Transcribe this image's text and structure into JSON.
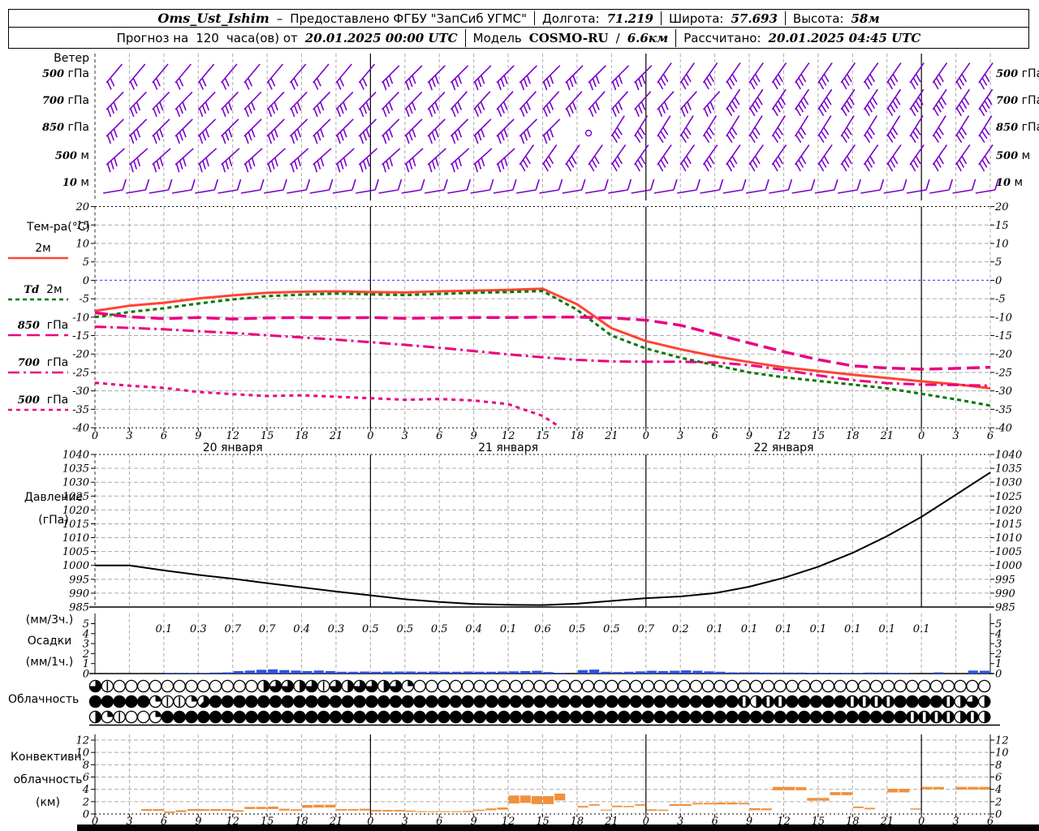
{
  "colors": {
    "wind": "#7A00CC",
    "t2m": "#FF4433",
    "td2m": "#007800",
    "magenta": "#EA0080",
    "zero_line": "#5050FF",
    "grid": "#AAAAAA",
    "precip_bar": "#2952E3",
    "conv_bar": "#F0913C",
    "pressure_line": "#000000"
  },
  "header": {
    "station": "Oms_Ust_Ishim",
    "dash": "–",
    "provided": "Предоставлено ФГБУ \"ЗапСиб УГМС\"",
    "lon_label": "Долгота:",
    "lon": "71.219",
    "lat_label": "Широта:",
    "lat": "57.693",
    "alt_label": "Высота:",
    "alt": "58м",
    "forecast_prefix": "Прогноз на",
    "forecast_hours": "120",
    "forecast_mid": "часа(ов) от",
    "forecast_start": "20.01.2025 00:00 UTC",
    "model_label": "Модель",
    "model": "COSMO-RU",
    "model_slash": "/",
    "model_res": "6.6км",
    "calc_label": "Рассчитано:",
    "calc_time": "20.01.2025 04:45 UTC"
  },
  "labels": {
    "wind_title": "Ветер",
    "temp_label": "Тем-ра(°C)",
    "pressure_label_1": "Давление",
    "pressure_label_2": "(гПа)",
    "precip_label_1": "(мм/3ч.)",
    "precip_label_2": "Осадки",
    "precip_label_3": "(мм/1ч.)",
    "cloud_label": "Облачность",
    "conv_label_1": "Конвективн.",
    "conv_label_2": "облачность",
    "conv_label_3": "(км)"
  },
  "wind": {
    "rows": [
      {
        "num": "500",
        "unit": "гПа",
        "segments": [
          [
            1,
            23,
            50,
            2
          ],
          [
            25,
            47,
            45,
            3
          ],
          [
            49,
            77,
            55,
            3
          ]
        ]
      },
      {
        "num": "700",
        "unit": "гПа",
        "segments": [
          [
            1,
            29,
            46,
            3
          ],
          [
            31,
            53,
            48,
            3
          ],
          [
            55,
            77,
            56,
            4
          ]
        ]
      },
      {
        "num": "850",
        "unit": "гПа",
        "segments": [
          [
            1,
            39,
            45,
            3
          ],
          [
            45,
            77,
            58,
            3
          ]
        ],
        "calm": [
          43
        ]
      },
      {
        "num": "500",
        "unit": "м",
        "segments": [
          [
            1,
            35,
            42,
            3
          ],
          [
            37,
            77,
            55,
            3
          ]
        ]
      },
      {
        "num": "10",
        "unit": "м",
        "segments": [
          [
            1,
            77,
            10,
            1
          ]
        ],
        "low": true
      }
    ]
  },
  "xaxis": {
    "hour_labels": [
      "0",
      "3",
      "6",
      "9",
      "12",
      "15",
      "18",
      "21",
      "0",
      "3",
      "6",
      "9",
      "12",
      "15",
      "18",
      "21",
      "0",
      "3",
      "6",
      "9",
      "12",
      "15",
      "18",
      "21",
      "0",
      "3",
      "6"
    ],
    "days": [
      {
        "label": "20 января",
        "h": 12
      },
      {
        "label": "21 января",
        "h": 36
      },
      {
        "label": "22 января",
        "h": 60
      }
    ]
  },
  "temp_legend": [
    {
      "num": "",
      "unit": "2м",
      "series": 0
    },
    {
      "num": "Td",
      "unit": "2м",
      "series": 1
    },
    {
      "num": "850",
      "unit": "гПа",
      "series": 2
    },
    {
      "num": "700",
      "unit": "гПа",
      "series": 3
    },
    {
      "num": "500",
      "unit": "гПа",
      "series": 4
    }
  ],
  "chart_data": [
    {
      "id": "temperature",
      "type": "line",
      "title": "Тем-ра(°C)",
      "ylim": [
        -40,
        20
      ],
      "yticks": [
        20,
        15,
        10,
        5,
        0,
        -5,
        -10,
        -15,
        -20,
        -25,
        -30,
        -35,
        -40
      ],
      "xlim_hours": [
        0,
        78
      ],
      "series": [
        {
          "name": "2м",
          "color": "#FF4433",
          "dash": "",
          "width": 3,
          "x": [
            0,
            3,
            6,
            9,
            12,
            15,
            18,
            21,
            24,
            27,
            30,
            33,
            36,
            39,
            42,
            45,
            48,
            51,
            54,
            57,
            60,
            63,
            66,
            69,
            72,
            75,
            78
          ],
          "values": [
            -8.3,
            -6.9,
            -6.1,
            -4.9,
            -4.1,
            -3.4,
            -3.1,
            -3.0,
            -3.2,
            -3.3,
            -3.0,
            -2.8,
            -2.6,
            -2.3,
            -6.5,
            -13.0,
            -16.5,
            -18.7,
            -20.6,
            -22.2,
            -23.6,
            -24.6,
            -25.6,
            -26.5,
            -27.4,
            -28.2,
            -29.3
          ]
        },
        {
          "name": "Td 2м",
          "color": "#007800",
          "dash": "5 4",
          "width": 3,
          "x": [
            0,
            3,
            6,
            9,
            12,
            15,
            18,
            21,
            24,
            27,
            30,
            33,
            36,
            39,
            42,
            45,
            48,
            51,
            54,
            57,
            60,
            63,
            66,
            69,
            72,
            75,
            78
          ],
          "values": [
            -10.0,
            -8.6,
            -7.6,
            -6.3,
            -5.2,
            -4.3,
            -3.9,
            -3.6,
            -3.8,
            -4.0,
            -3.7,
            -3.4,
            -3.2,
            -2.9,
            -8.0,
            -15.0,
            -18.5,
            -21.0,
            -23.0,
            -25.0,
            -26.3,
            -27.3,
            -28.3,
            -29.3,
            -30.8,
            -32.3,
            -34.0
          ]
        },
        {
          "name": "850 гПа",
          "color": "#EA0080",
          "dash": "16 7",
          "width": 3.5,
          "x": [
            0,
            3,
            6,
            9,
            12,
            15,
            18,
            21,
            24,
            27,
            30,
            33,
            36,
            39,
            42,
            45,
            48,
            51,
            54,
            57,
            60,
            63,
            66,
            69,
            72,
            75,
            78
          ],
          "values": [
            -8.8,
            -9.9,
            -10.4,
            -10.1,
            -10.5,
            -10.2,
            -10.1,
            -10.2,
            -10.1,
            -10.3,
            -10.2,
            -10.1,
            -10.1,
            -10.0,
            -10.0,
            -10.2,
            -10.8,
            -12.2,
            -14.6,
            -17.0,
            -19.4,
            -21.5,
            -23.2,
            -23.8,
            -24.1,
            -23.9,
            -23.6
          ]
        },
        {
          "name": "700 гПа",
          "color": "#EA0080",
          "dash": "14 5 3 5",
          "width": 3,
          "x": [
            0,
            3,
            6,
            9,
            12,
            15,
            18,
            21,
            24,
            27,
            30,
            33,
            36,
            39,
            42,
            45,
            48,
            51,
            54,
            57,
            60,
            63,
            66,
            69,
            72,
            75,
            78
          ],
          "values": [
            -12.6,
            -12.9,
            -13.3,
            -13.8,
            -14.3,
            -14.9,
            -15.5,
            -16.1,
            -16.8,
            -17.5,
            -18.3,
            -19.2,
            -20.1,
            -20.9,
            -21.6,
            -22.0,
            -22.1,
            -22.1,
            -22.3,
            -23.0,
            -24.3,
            -25.8,
            -27.1,
            -27.9,
            -28.3,
            -28.4,
            -28.6
          ]
        },
        {
          "name": "500 гПа",
          "color": "#EA0080",
          "dash": "5 5",
          "width": 3,
          "x": [
            0,
            3,
            6,
            9,
            12,
            15,
            18,
            21,
            24,
            27,
            30,
            33,
            36,
            39,
            40.5
          ],
          "values": [
            -27.8,
            -28.6,
            -29.2,
            -30.3,
            -30.9,
            -31.4,
            -31.2,
            -31.6,
            -32.0,
            -32.4,
            -32.2,
            -32.6,
            -33.6,
            -36.8,
            -39.8
          ]
        }
      ]
    },
    {
      "id": "pressure",
      "type": "line",
      "title": "Давление (гПа)",
      "ylim": [
        985,
        1040
      ],
      "yticks": [
        1040,
        1035,
        1030,
        1025,
        1020,
        1015,
        1010,
        1005,
        1000,
        995,
        990,
        985
      ],
      "x_step": 3,
      "values": [
        1000,
        1000,
        998.2,
        996.6,
        995.2,
        993.6,
        992.1,
        990.6,
        989.2,
        987.8,
        986.8,
        986.1,
        985.8,
        985.7,
        986.2,
        987.2,
        988.2,
        988.8,
        990.0,
        992.3,
        995.5,
        999.5,
        1004.5,
        1010.5,
        1017.5,
        1025.5,
        1033.5
      ]
    },
    {
      "id": "precipitation",
      "type": "bar",
      "title": "Осадки (мм/3ч.) / (мм/1ч.)",
      "ylim": [
        0,
        6
      ],
      "yticks": [
        0,
        1,
        2,
        3,
        4,
        5
      ],
      "amount_3h_start_hour": 6,
      "amount_3h_labels": [
        "0.1",
        "0.3",
        "0.7",
        "0.7",
        "0.4",
        "0.3",
        "0.5",
        "0.5",
        "0.5",
        "0.4",
        "0.1",
        "0.6",
        "0.5",
        "0.5",
        "0.7",
        "0.2",
        "0.1",
        "0.1",
        "0.1",
        "0.1",
        "0.1",
        "0.1",
        "0.1"
      ],
      "hourly_mm": [
        0,
        0,
        0,
        0,
        0,
        0,
        0.07,
        0.07,
        0.04,
        0.05,
        0.1,
        0.12,
        0.25,
        0.3,
        0.38,
        0.42,
        0.35,
        0.3,
        0.25,
        0.3,
        0.25,
        0.18,
        0.18,
        0.2,
        0.18,
        0.2,
        0.2,
        0.2,
        0.18,
        0.2,
        0.18,
        0.18,
        0.2,
        0.18,
        0.18,
        0.2,
        0.22,
        0.25,
        0.28,
        0.15,
        0.08,
        0,
        0.35,
        0.4,
        0.18,
        0.15,
        0.18,
        0.22,
        0.28,
        0.25,
        0.28,
        0.32,
        0.28,
        0.22,
        0.18,
        0.12,
        0.12,
        0.12,
        0.1,
        0.1,
        0.1,
        0.1,
        0.08,
        0.08,
        0.08,
        0.06,
        0.05,
        0.1,
        0.1,
        0.08,
        0.06,
        0,
        0,
        0.12,
        0,
        0,
        0.3,
        0.28
      ]
    },
    {
      "id": "cloudiness",
      "type": "symbols",
      "title": "Облачность",
      "okta_rows": [
        [
          6,
          1,
          0,
          0,
          0,
          0,
          0,
          0,
          0,
          0,
          0,
          0,
          0,
          0,
          4,
          6,
          6,
          4,
          6,
          1,
          6,
          4,
          6,
          6,
          4,
          6,
          2,
          0,
          0,
          0,
          0,
          0,
          0,
          0,
          0,
          0,
          0,
          0,
          0,
          0,
          0,
          0,
          0,
          0,
          0,
          0,
          0,
          0,
          0,
          0,
          0,
          0,
          0,
          0,
          0,
          0,
          0,
          0,
          0,
          0,
          0,
          0,
          0,
          0,
          0,
          0,
          0,
          0,
          0,
          0,
          0,
          0,
          0,
          0,
          0
        ],
        [
          8,
          8,
          8,
          8,
          8,
          2,
          1,
          1,
          2,
          5,
          8,
          8,
          8,
          8,
          8,
          8,
          8,
          8,
          8,
          8,
          8,
          8,
          8,
          8,
          8,
          8,
          8,
          8,
          8,
          8,
          8,
          8,
          8,
          8,
          8,
          8,
          8,
          8,
          8,
          8,
          8,
          8,
          8,
          8,
          8,
          8,
          8,
          8,
          8,
          8,
          8,
          8,
          8,
          8,
          7,
          4,
          7,
          7,
          8,
          8,
          8,
          8,
          8,
          7,
          7,
          7,
          7,
          8,
          8,
          8,
          8,
          7,
          4,
          6,
          4
        ],
        [
          4,
          2,
          1,
          0,
          0,
          2,
          8,
          8,
          8,
          8,
          8,
          8,
          8,
          8,
          8,
          8,
          8,
          8,
          8,
          8,
          8,
          8,
          8,
          8,
          8,
          8,
          8,
          8,
          8,
          8,
          8,
          8,
          8,
          8,
          8,
          8,
          8,
          8,
          8,
          8,
          8,
          8,
          8,
          8,
          8,
          8,
          8,
          8,
          8,
          8,
          8,
          8,
          8,
          8,
          8,
          8,
          8,
          8,
          8,
          8,
          8,
          8,
          8,
          8,
          8,
          8,
          8,
          8,
          7,
          7,
          7,
          7,
          4,
          7,
          4
        ]
      ]
    },
    {
      "id": "convective_cloud",
      "type": "bar",
      "title": "Конвективн. облачность (км)",
      "ylim": [
        0,
        13
      ],
      "yticks": [
        0,
        2,
        4,
        6,
        8,
        10,
        12
      ],
      "bars_h_base_top": [
        [
          4,
          0.5,
          0.8
        ],
        [
          5,
          0.5,
          0.8
        ],
        [
          6,
          0.15,
          0.4
        ],
        [
          7,
          0.3,
          0.6
        ],
        [
          8,
          0.5,
          0.8
        ],
        [
          9,
          0.5,
          0.8
        ],
        [
          10,
          0.5,
          0.8
        ],
        [
          11,
          0.5,
          0.8
        ],
        [
          12,
          0.35,
          0.6
        ],
        [
          13,
          0.8,
          1.15
        ],
        [
          14,
          0.8,
          1.15
        ],
        [
          15,
          0.8,
          1.2
        ],
        [
          16,
          0.55,
          0.85
        ],
        [
          17,
          0.5,
          0.75
        ],
        [
          18,
          1.0,
          1.45
        ],
        [
          19,
          1.05,
          1.5
        ],
        [
          20,
          1.05,
          1.5
        ],
        [
          21,
          0.55,
          0.8
        ],
        [
          22,
          0.55,
          0.8
        ],
        [
          23,
          0.55,
          0.85
        ],
        [
          24,
          0.4,
          0.65
        ],
        [
          25,
          0.4,
          0.65
        ],
        [
          26,
          0.4,
          0.65
        ],
        [
          27,
          0.35,
          0.55
        ],
        [
          28,
          0.3,
          0.45
        ],
        [
          29,
          0.3,
          0.45
        ],
        [
          30,
          0.3,
          0.45
        ],
        [
          31,
          0.3,
          0.45
        ],
        [
          32,
          0.3,
          0.5
        ],
        [
          33,
          0.5,
          0.7
        ],
        [
          34,
          0.6,
          0.9
        ],
        [
          35,
          0.7,
          1.05
        ],
        [
          36,
          1.7,
          3.0
        ],
        [
          37,
          1.8,
          3.0
        ],
        [
          38,
          1.6,
          2.9
        ],
        [
          39,
          1.6,
          2.9
        ],
        [
          40,
          2.2,
          3.3
        ],
        [
          42,
          1.05,
          1.3
        ],
        [
          43,
          1.35,
          1.6
        ],
        [
          44,
          0.55,
          0.7
        ],
        [
          45,
          1.1,
          1.35
        ],
        [
          46,
          1.1,
          1.3
        ],
        [
          47,
          1.35,
          1.6
        ],
        [
          48,
          0.5,
          0.75
        ],
        [
          49,
          0.5,
          0.7
        ],
        [
          50,
          1.3,
          1.6
        ],
        [
          51,
          1.3,
          1.6
        ],
        [
          52,
          1.55,
          1.8
        ],
        [
          53,
          1.55,
          1.8
        ],
        [
          54,
          1.55,
          1.85
        ],
        [
          55,
          1.55,
          1.85
        ],
        [
          56,
          1.55,
          1.8
        ],
        [
          57,
          0.6,
          0.95
        ],
        [
          58,
          0.6,
          0.9
        ],
        [
          59,
          3.85,
          4.4
        ],
        [
          60,
          3.85,
          4.4
        ],
        [
          61,
          3.85,
          4.35
        ],
        [
          62,
          2.15,
          2.6
        ],
        [
          63,
          2.15,
          2.6
        ],
        [
          64,
          3.05,
          3.55
        ],
        [
          65,
          3.05,
          3.55
        ],
        [
          66,
          0.95,
          1.2
        ],
        [
          67,
          0.75,
          1.0
        ],
        [
          69,
          3.5,
          4.1
        ],
        [
          70,
          3.5,
          4.1
        ],
        [
          71,
          0.7,
          0.9
        ],
        [
          72,
          4.0,
          4.4
        ],
        [
          73,
          4.0,
          4.4
        ],
        [
          75,
          3.95,
          4.4
        ],
        [
          76,
          3.95,
          4.4
        ],
        [
          77,
          3.95,
          4.4
        ]
      ]
    }
  ]
}
